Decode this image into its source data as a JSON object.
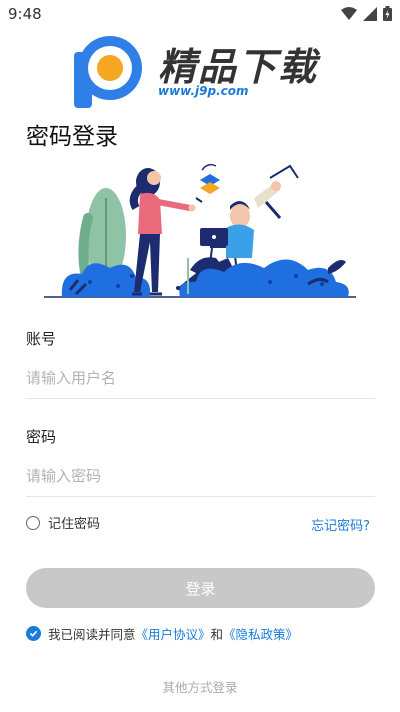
{
  "status_bar": {
    "time": "9:48",
    "icons": [
      "wifi-icon",
      "cellular-icon",
      "battery-icon"
    ]
  },
  "watermark": {
    "title": "精品下载",
    "url": "www.j9p.com",
    "logo": "j9p-logo-icon"
  },
  "page": {
    "title": "密码登录"
  },
  "illustration": {
    "name": "login-illustration",
    "colors": {
      "blue": "#1f6fe0",
      "green": "#8fc3a5",
      "pink": "#e96a7a",
      "navy": "#1c2c6e"
    }
  },
  "form": {
    "account_label": "账号",
    "account_placeholder": "请输入用户名",
    "password_label": "密码",
    "password_placeholder": "请输入密码"
  },
  "options": {
    "remember_label": "记住密码",
    "forgot_label": "忘记密码?"
  },
  "login_button": {
    "label": "登录",
    "color": "#c8c8c8"
  },
  "agreement": {
    "prefix": "我已阅读并同意",
    "user_agreement": "《用户协议》",
    "and": "和",
    "privacy_policy": "《隐私政策》",
    "checked": true
  },
  "other_login": {
    "label": "其他方式登录"
  },
  "theme": {
    "accent": "#1a7bd8"
  }
}
